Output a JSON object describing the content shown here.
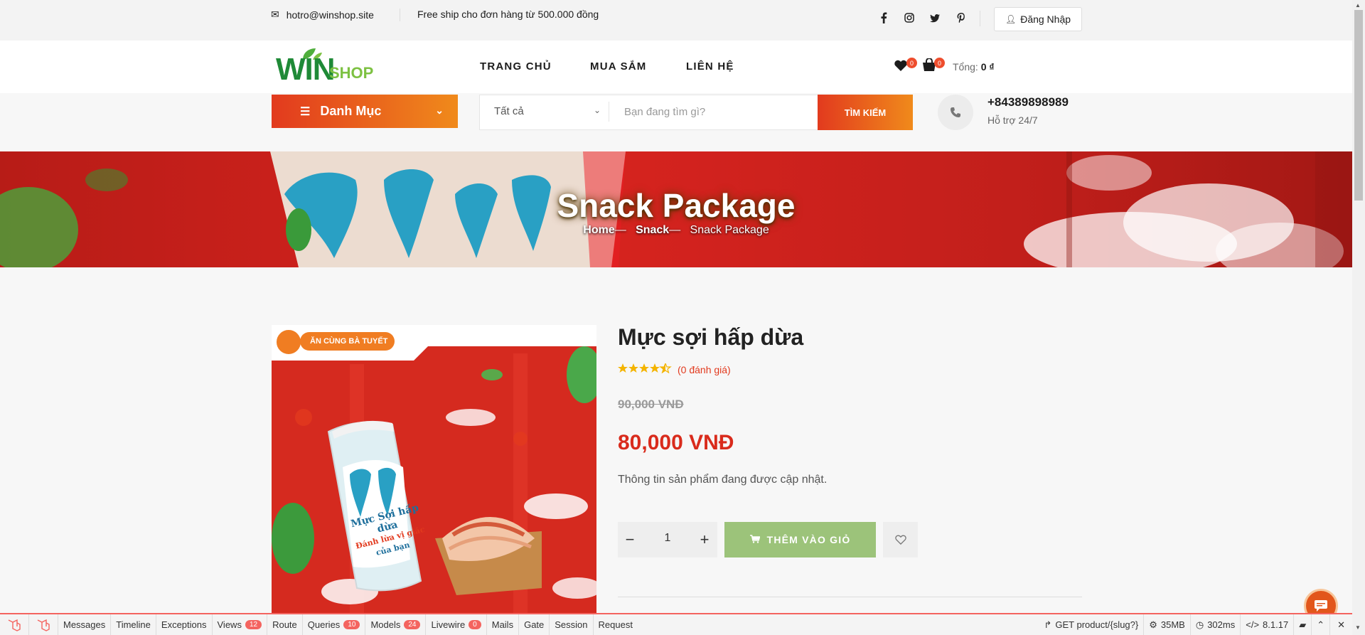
{
  "topbar": {
    "email": "hotro@winshop.site",
    "shipping": "Free ship cho đơn hàng từ 500.000 đồng",
    "social": [
      "facebook-icon",
      "instagram-icon",
      "twitter-icon",
      "pinterest-icon"
    ],
    "login_label": "Đăng Nhập"
  },
  "header": {
    "logo_win": "WIN",
    "logo_shop": "SHOP",
    "nav": [
      "TRANG CHỦ",
      "MUA SẮM",
      "LIÊN HỆ"
    ],
    "wishlist_count": "0",
    "cart_count": "0",
    "total_label": "Tổng:",
    "total_value": "0 ₫"
  },
  "search": {
    "category_button": "Danh Mục",
    "select_value": "Tất cả",
    "placeholder": "Bạn đang tìm gì?",
    "button": "TÌM KIẾM",
    "phone": "+84389898989",
    "support": "Hỗ trợ 24/7"
  },
  "hero": {
    "title": "Snack Package",
    "breadcrumb": [
      "Home",
      "Snack",
      "Snack Package"
    ]
  },
  "product": {
    "title": "Mực sợi hấp dừa",
    "rating": 4.5,
    "reviews": "(0 đánh giá)",
    "old_price": "90,000 VNĐ",
    "price": "80,000 VNĐ",
    "description": "Thông tin sản phẩm đang được cập nhật.",
    "quantity": "1",
    "add_to_cart": "THÊM VÀO GIỎ",
    "image_badge": "ĂN CÙNG BÀ TUYẾT",
    "package_text": [
      "Mực Sợi hấp dừa",
      "Đánh lừa vị giác",
      "của bạn"
    ]
  },
  "debugbar": {
    "items": [
      {
        "label": "Messages",
        "badge": null
      },
      {
        "label": "Timeline",
        "badge": null
      },
      {
        "label": "Exceptions",
        "badge": null
      },
      {
        "label": "Views",
        "badge": "12"
      },
      {
        "label": "Route",
        "badge": null
      },
      {
        "label": "Queries",
        "badge": "10"
      },
      {
        "label": "Models",
        "badge": "24"
      },
      {
        "label": "Livewire",
        "badge": "0"
      },
      {
        "label": "Mails",
        "badge": null
      },
      {
        "label": "Gate",
        "badge": null
      },
      {
        "label": "Session",
        "badge": null
      },
      {
        "label": "Request",
        "badge": null
      }
    ],
    "route": "GET product/{slug?}",
    "memory": "35MB",
    "time": "302ms",
    "php": "8.1.17"
  },
  "colors": {
    "accent": "#e23a1e",
    "accent2": "#f08a1b",
    "price": "#d92b1c",
    "add_cart": "#9cc37a",
    "brand_green": "#1f8a37"
  }
}
